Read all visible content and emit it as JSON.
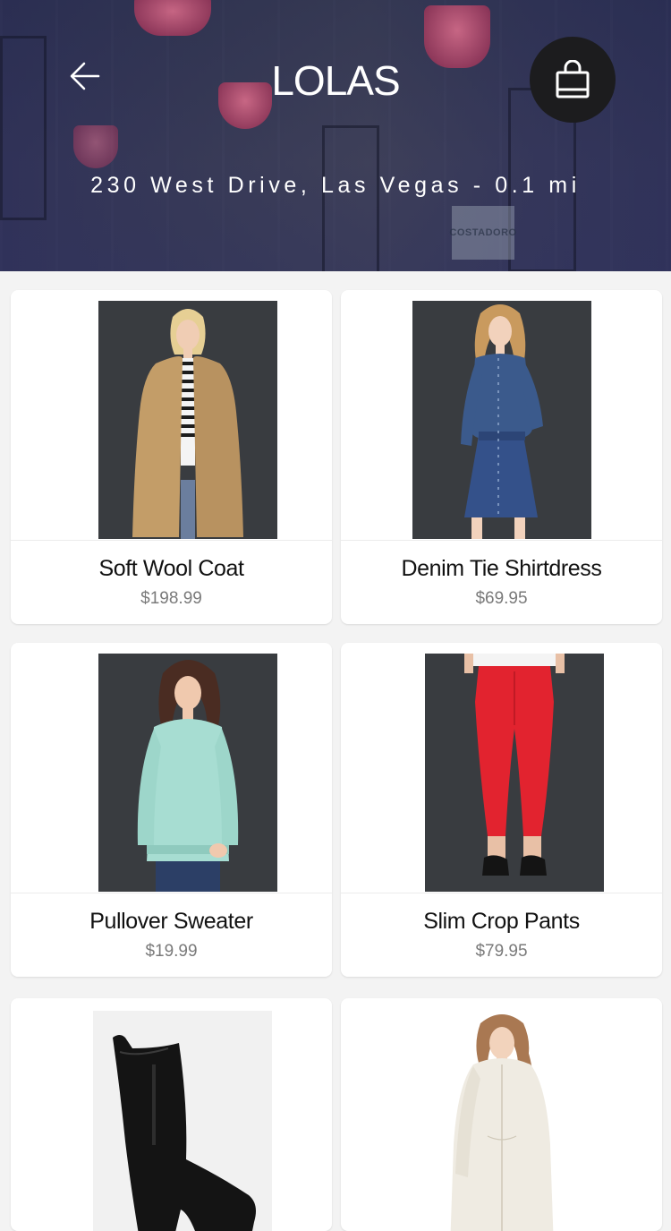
{
  "header": {
    "store_name": "LOLAS",
    "address": "230 West Drive, Las Vegas - 0.1 mi",
    "background_sign_text": "COSTADORO",
    "back_icon": "arrow-left-icon",
    "cart_icon": "shopping-bag-icon"
  },
  "colors": {
    "header_overlay": "#2a2f55",
    "cart_button": "#1c1c1e",
    "card_background": "#ffffff",
    "page_background": "#f3f3f3",
    "price_text": "#7a7a7a"
  },
  "products": [
    {
      "name": "Soft Wool Coat",
      "price": "$198.99",
      "image": "woman-camel-coat-photo"
    },
    {
      "name": "Denim Tie Shirtdress",
      "price": "$69.95",
      "image": "woman-denim-dress-photo"
    },
    {
      "name": "Pullover Sweater",
      "price": "$19.99",
      "image": "woman-mint-sweater-photo"
    },
    {
      "name": "Slim Crop Pants",
      "price": "$79.95",
      "image": "red-crop-pants-photo"
    },
    {
      "name": "",
      "price": "",
      "image": "black-ankle-boot-photo"
    },
    {
      "name": "",
      "price": "",
      "image": "woman-white-jacket-photo"
    }
  ]
}
